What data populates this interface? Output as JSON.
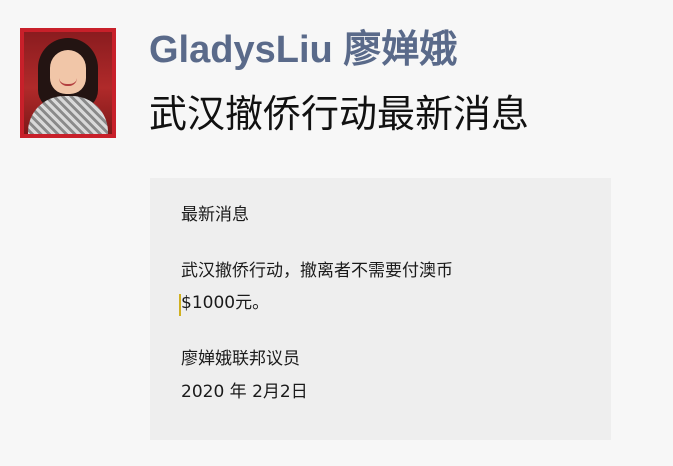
{
  "post": {
    "author": "GladysLiu 廖婵娥",
    "title": "武汉撤侨行动最新消息",
    "avatar_icon": "profile-photo-icon"
  },
  "card": {
    "heading": "最新消息",
    "body_line1": "武汉撤侨行动，撤离者不需要付澳币",
    "body_line2": "$1000元。",
    "signer": "廖婵娥联邦议员",
    "date": "2020 年 2月2日"
  },
  "colors": {
    "page_background": "#f7f7f7",
    "card_background": "#eeeeee",
    "author_color": "#5a6a8a",
    "avatar_border": "#c8202a"
  }
}
